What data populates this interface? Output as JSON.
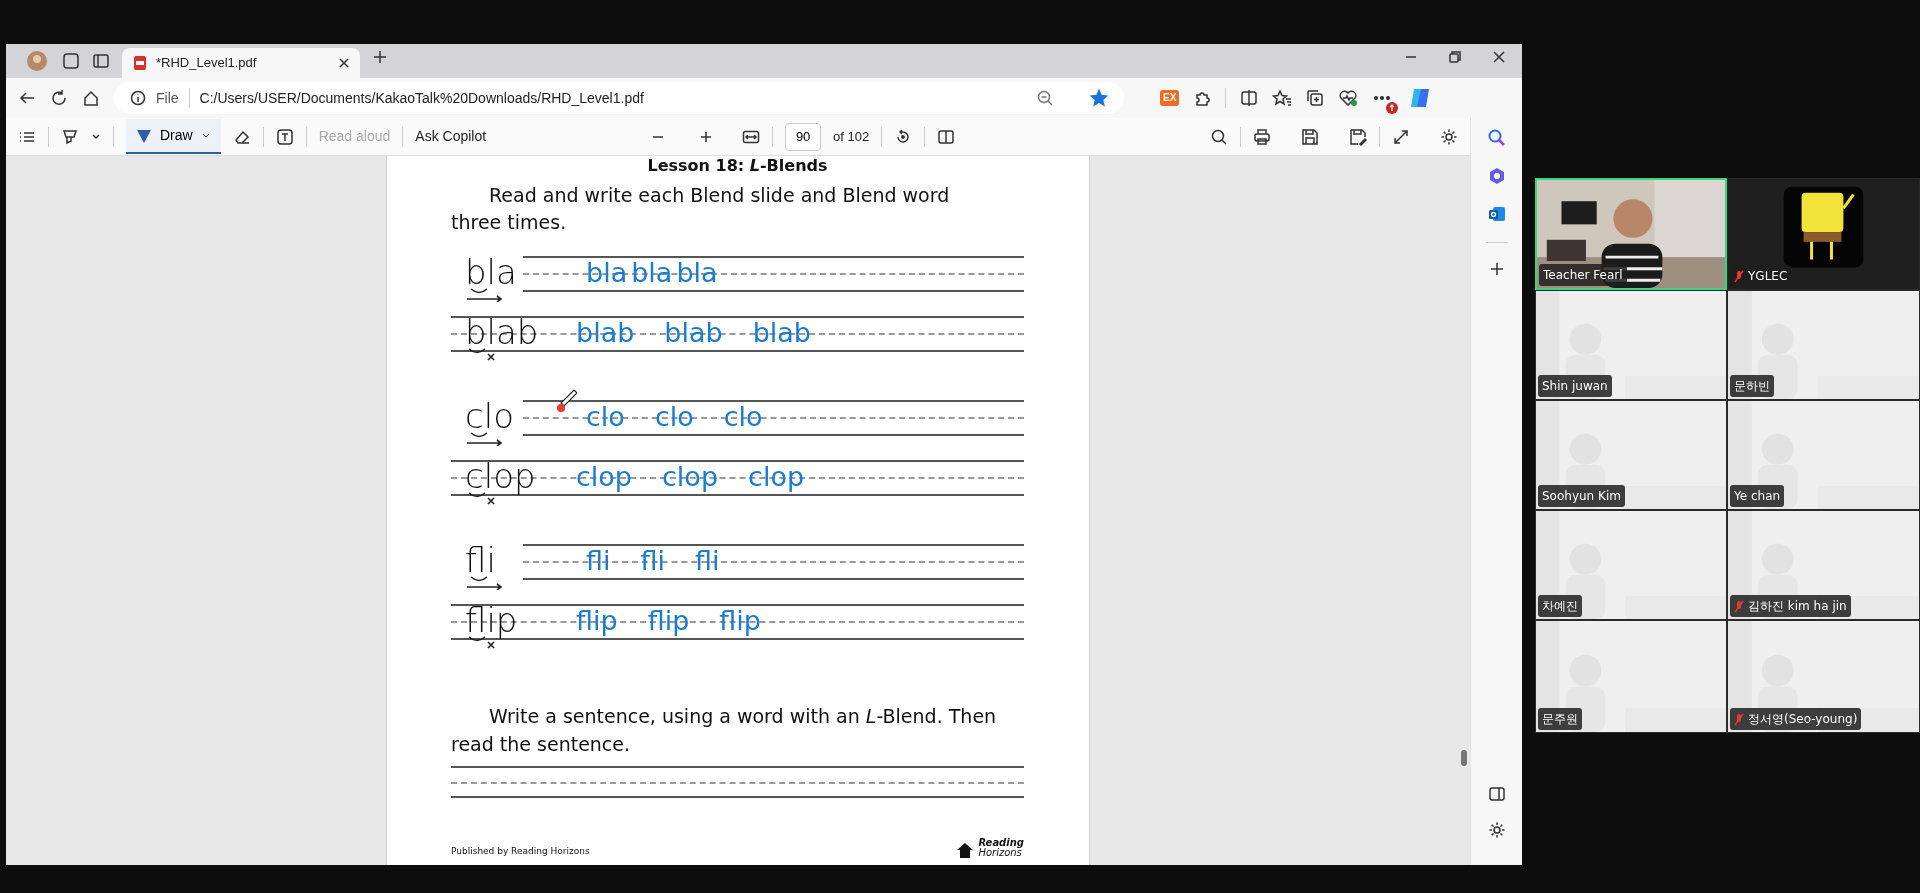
{
  "browser": {
    "tabs": [
      {
        "title": "*RHD_Level1.pdf",
        "selected": true
      }
    ],
    "address": {
      "scheme": "File",
      "url": "C:/Users/USER/Documents/KakaoTalk%20Downloads/RHD_Level1.pdf",
      "favorite": true
    },
    "extension_label": "EX",
    "pdf_toolbar": {
      "draw": {
        "label": "Draw",
        "selected": true
      },
      "read_aloud": {
        "label": "Read aloud",
        "disabled": true
      },
      "ask_copilot": "Ask Copilot",
      "page": "90",
      "page_count": "of 102"
    }
  },
  "document": {
    "heading": "Lesson 18: *L*-Blends",
    "instruction": "Read and write each Blend slide and Blend word three times.",
    "exercises": [
      {
        "kind": "slide",
        "model": "bla",
        "handwriting": [
          "bla",
          "bla",
          "bla"
        ]
      },
      {
        "kind": "word",
        "model": "blab",
        "handwriting": [
          "blab",
          "blab",
          "blab"
        ]
      },
      {
        "kind": "slide",
        "model": "clo",
        "handwriting": [
          "clo",
          "clo",
          "clo"
        ]
      },
      {
        "kind": "word",
        "model": "clop",
        "handwriting": [
          "clop",
          "clop",
          "clop"
        ]
      },
      {
        "kind": "slide",
        "model": "fli",
        "handwriting": [
          "fli",
          "fli",
          "fli"
        ]
      },
      {
        "kind": "word",
        "model": "flip",
        "handwriting": [
          "flip",
          "flip",
          "flip"
        ]
      }
    ],
    "sentence_prompt": "Write a sentence, using a word with an *L*-Blend. Then read the sentence.",
    "publisher": "Published by Reading Horizons",
    "logo": [
      "Reading",
      "Horizons"
    ]
  },
  "participants": [
    {
      "name": "Teacher Fearl",
      "muted": false,
      "speaking": true,
      "kind": "video"
    },
    {
      "name": "YGLEC",
      "muted": true,
      "speaking": false,
      "kind": "avatar"
    },
    {
      "name": "Shin juwan",
      "muted": false,
      "speaking": false,
      "kind": "video"
    },
    {
      "name": "문하빈",
      "muted": false,
      "speaking": false,
      "kind": "video"
    },
    {
      "name": "Soohyun Kim",
      "muted": false,
      "speaking": false,
      "kind": "video"
    },
    {
      "name": "Ye chan",
      "muted": false,
      "speaking": false,
      "kind": "video"
    },
    {
      "name": "차예진",
      "muted": false,
      "speaking": false,
      "kind": "video"
    },
    {
      "name": "김하진 kim ha jin",
      "muted": true,
      "speaking": false,
      "kind": "video"
    },
    {
      "name": "문주원",
      "muted": false,
      "speaking": false,
      "kind": "video"
    },
    {
      "name": "정서영(Seo-young)",
      "muted": true,
      "speaking": false,
      "kind": "video"
    }
  ]
}
